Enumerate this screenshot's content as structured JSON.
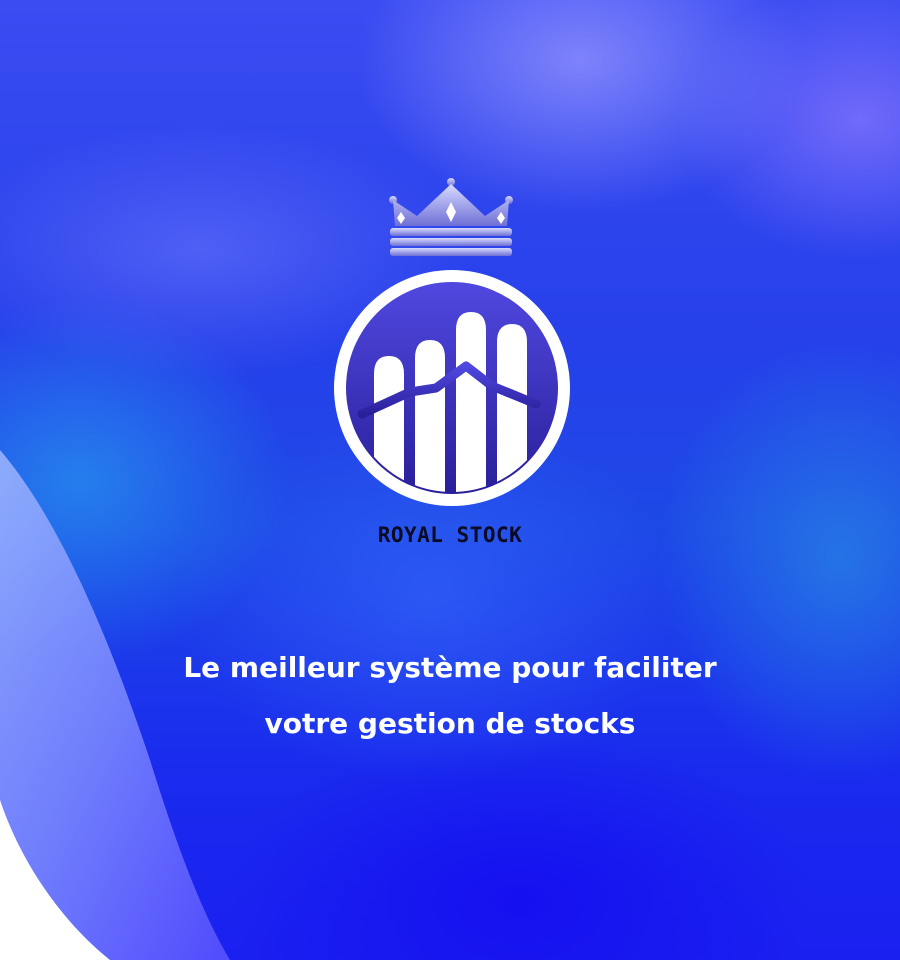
{
  "brand": {
    "name": "ROYAL STOCK",
    "logo_icon": "royal-stock-logo-icon",
    "crown_icon": "crown-icon"
  },
  "tagline": {
    "line1": "Le meilleur système pour faciliter",
    "line2": "votre gestion de stocks"
  },
  "colors": {
    "background_primary": "#1a2bee",
    "emblem_fill": "#3b33c6",
    "emblem_ring": "#ffffff",
    "brand_text": "#0a0a24",
    "tagline_text": "#ffffff"
  }
}
